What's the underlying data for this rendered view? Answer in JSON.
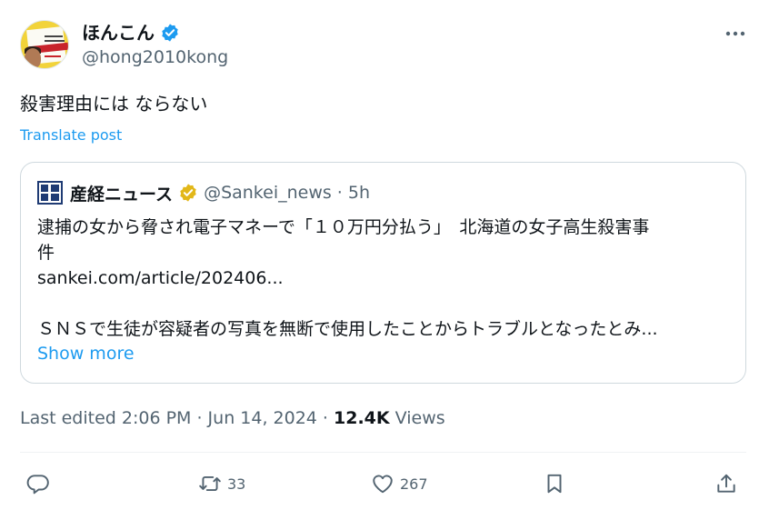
{
  "author": {
    "display_name": "ほんこん",
    "handle": "@hong2010kong",
    "verified_icon": "verified-badge-icon",
    "avatar_book_text": "ウイルスから日本を守る国防"
  },
  "post": {
    "text": "殺害理由には ならない",
    "translate_label": "Translate post"
  },
  "quoted_post": {
    "display_name": "産経ニュース",
    "handle_time": "@Sankei_news · 5h",
    "lines": [
      "逮捕の女から脅され電子マネーで「１０万円分払う」　北海道の女子高生殺害事",
      "件",
      "sankei.com/article/202406...",
      "",
      "ＳＮＳで生徒が容疑者の写真を無断で使用したことからトラブルとなったとみ..."
    ],
    "show_more": "Show more"
  },
  "meta": {
    "edited_time": "Last edited 2:06 PM · Jun 14, 2024 · ",
    "views_count": "12.4K",
    "views_label": " Views"
  },
  "actions": {
    "reply_icon": "reply-icon",
    "repost_icon": "repost-icon",
    "repost_count": "33",
    "like_icon": "heart-icon",
    "like_count": "267",
    "bookmark_icon": "bookmark-icon",
    "share_icon": "share-icon"
  },
  "colors": {
    "accent": "#1d9bf0",
    "text": "#0f1419",
    "secondary": "#536471",
    "verified_blue": "#1d9bf0",
    "verified_gold": "#e2b719"
  }
}
